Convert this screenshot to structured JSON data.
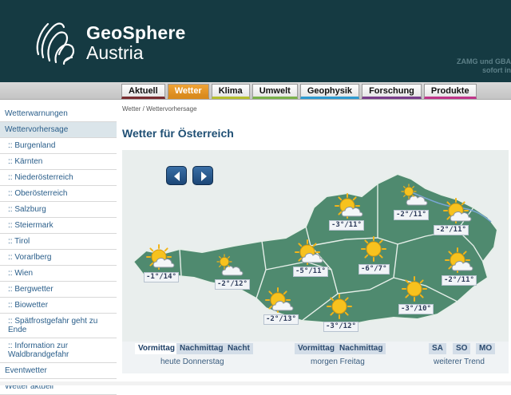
{
  "brand": {
    "line1": "GeoSphere",
    "line2": "Austria",
    "note_line1": "ZAMG und GBA",
    "note_line2": "sofort in"
  },
  "nav": {
    "tabs": [
      {
        "label": "Aktuell",
        "color": "#7a2d30"
      },
      {
        "label": "Wetter",
        "color": "#d98a1c"
      },
      {
        "label": "Klima",
        "color": "#b7bf2e"
      },
      {
        "label": "Umwelt",
        "color": "#7bb24a"
      },
      {
        "label": "Geophysik",
        "color": "#2f9bd1"
      },
      {
        "label": "Forschung",
        "color": "#7a3e8c"
      },
      {
        "label": "Produkte",
        "color": "#c0358a"
      }
    ]
  },
  "sidebar": {
    "items": [
      {
        "label": "Wetterwarnungen"
      },
      {
        "label": "Wettervorhersage"
      },
      {
        "label": ":: Burgenland"
      },
      {
        "label": ":: Kärnten"
      },
      {
        "label": ":: Niederösterreich"
      },
      {
        "label": ":: Oberösterreich"
      },
      {
        "label": ":: Salzburg"
      },
      {
        "label": ":: Steiermark"
      },
      {
        "label": ":: Tirol"
      },
      {
        "label": ":: Vorarlberg"
      },
      {
        "label": ":: Wien"
      },
      {
        "label": ":: Bergwetter"
      },
      {
        "label": ":: Biowetter"
      },
      {
        "label": ":: Spätfrostgefahr geht zu Ende"
      },
      {
        "label": ":: Information zur Waldbrandgefahr"
      },
      {
        "label": "Eventwetter"
      },
      {
        "label": "Wetter aktuell"
      }
    ]
  },
  "breadcrumb": "Wetter / Wettervorhersage",
  "title": "Wetter für Österreich",
  "map": {
    "temps": [
      "-1°/14°",
      "-2°/12°",
      "-2°/13°",
      "-5°/11°",
      "-3°/11°",
      "-6°/7°",
      "-3°/12°",
      "-3°/10°",
      "-2°/11°",
      "-2°/11°",
      "-2°/11°"
    ]
  },
  "tabs": {
    "today": [
      "Vormittag",
      "Nachmittag",
      "Nacht"
    ],
    "tomorrow": [
      "Vormittag",
      "Nachmittag"
    ],
    "trend": [
      "SA",
      "SO",
      "MO"
    ],
    "day_labels": [
      "heute Donnerstag",
      "morgen Freitag",
      "weiterer Trend"
    ]
  }
}
